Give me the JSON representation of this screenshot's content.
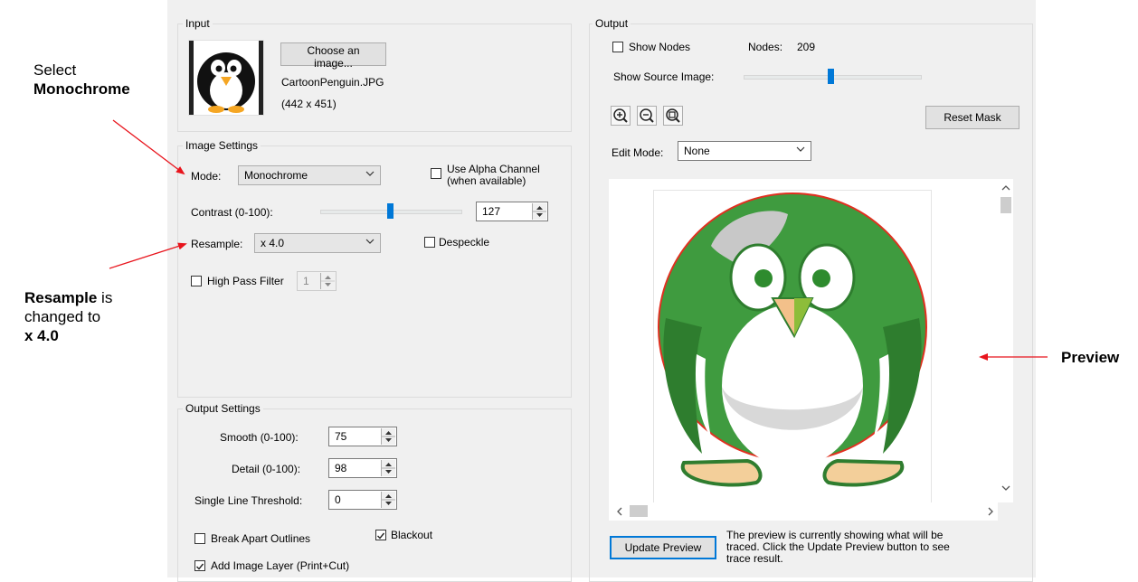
{
  "annotations": {
    "select_line1": "Select",
    "select_line2": "Monochrome",
    "resample_line1": "Resample",
    "resample_line2": " is",
    "resample_line3": "changed to",
    "resample_line4": "x 4.0",
    "preview": "Preview"
  },
  "input": {
    "title": "Input",
    "choose_button": "Choose an image...",
    "filename": "CartoonPenguin.JPG",
    "dimensions": "(442 x 451)"
  },
  "image_settings": {
    "title": "Image Settings",
    "mode_label": "Mode:",
    "mode_value": "Monochrome",
    "alpha_line1": "Use Alpha Channel",
    "alpha_line2": "(when available)",
    "contrast_label": "Contrast (0-100):",
    "contrast_value": "127",
    "contrast_level": 0.75,
    "resample_label": "Resample:",
    "resample_value": "x 4.0",
    "despeckle_label": "Despeckle",
    "high_pass_label": "High Pass Filter",
    "high_pass_value": "1"
  },
  "output_settings": {
    "title": "Output Settings",
    "smooth_label": "Smooth (0-100):",
    "smooth_value": "75",
    "detail_label": "Detail (0-100):",
    "detail_value": "98",
    "threshold_label": "Single Line Threshold:",
    "threshold_value": "0",
    "break_apart_label": "Break Apart Outlines",
    "blackout_label": "Blackout",
    "blackout_checked": true,
    "add_layer_label": "Add Image Layer (Print+Cut)",
    "add_layer_checked": true
  },
  "output": {
    "title": "Output",
    "show_nodes_label": "Show Nodes",
    "nodes_label": "Nodes:",
    "nodes_value": "209",
    "show_source_label": "Show Source Image:",
    "source_level": 0.5,
    "reset_mask_button": "Reset Mask",
    "edit_mode_label": "Edit Mode:",
    "edit_mode_value": "None",
    "update_preview_button": "Update Preview",
    "preview_note_line1": "The preview is currently showing what will be",
    "preview_note_line2": "traced. Click the Update Preview button to see",
    "preview_note_line3": "trace result."
  },
  "icons": [
    "zoom-in-icon",
    "zoom-out-icon",
    "zoom-fit-icon",
    "chevron-down-icon",
    "chevron-up-icon",
    "chevron-left-icon",
    "chevron-right-icon",
    "arrow-icon"
  ],
  "colors": {
    "accent": "#0078d7",
    "annotation_arrow": "#e8141c",
    "trace_outline": "#e03020",
    "penguin_green": "#3f9b3f"
  }
}
